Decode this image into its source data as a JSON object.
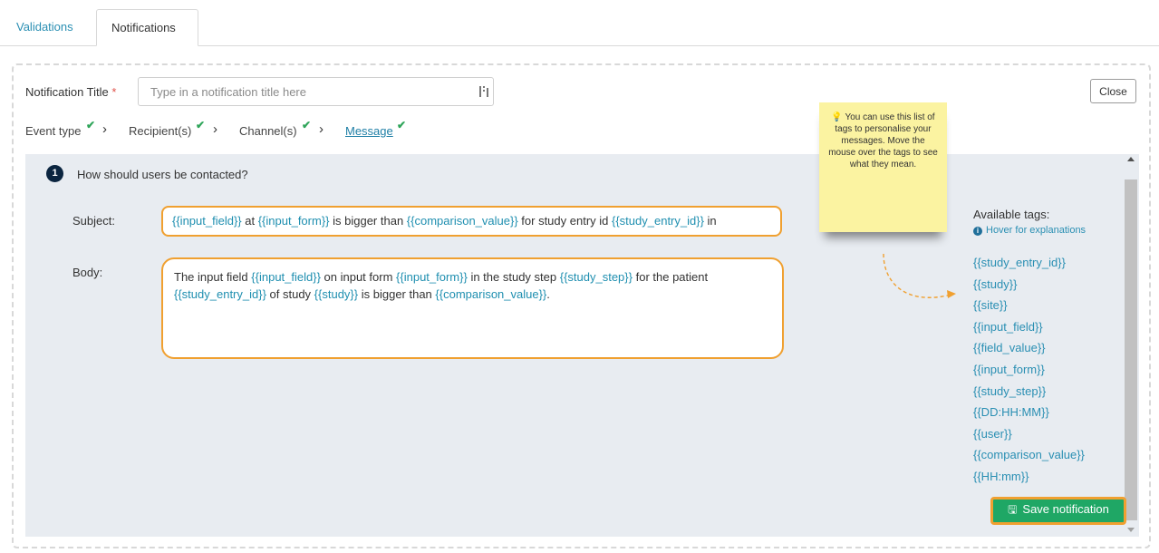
{
  "tabs": [
    {
      "label": "Validations",
      "active": false
    },
    {
      "label": "Notifications",
      "active": true
    }
  ],
  "form": {
    "title_label": "Notification Title",
    "required_mark": "*",
    "title_placeholder": "Type in a notification title here",
    "title_value": "",
    "close_label": "Close"
  },
  "steps": [
    {
      "label": "Event type",
      "done": true,
      "active": false
    },
    {
      "label": "Recipient(s)",
      "done": true,
      "active": false
    },
    {
      "label": "Channel(s)",
      "done": true,
      "active": false
    },
    {
      "label": "Message",
      "done": true,
      "active": true
    }
  ],
  "question": {
    "number": "1",
    "text": "How should users be contacted?"
  },
  "message": {
    "subject_label": "Subject:",
    "body_label": "Body:"
  },
  "tip": {
    "text": "You can use this list of tags to personalise your messages. Move the mouse over the tags to see what they mean."
  },
  "tags_panel": {
    "title": "Available tags:",
    "hint": "Hover for explanations",
    "tags": [
      "{{study_entry_id}}",
      "{{study}}",
      "{{site}}",
      "{{input_field}}",
      "{{field_value}}",
      "{{input_form}}",
      "{{study_step}}",
      "{{DD:HH:MM}}",
      "{{user}}",
      "{{comparison_value}}",
      "{{HH:mm}}"
    ]
  },
  "save_label": "Save notification",
  "colors": {
    "accent": "#2a8fb3",
    "highlight": "#f0a030",
    "save_green": "#1fa765",
    "check_green": "#2fa55a"
  }
}
